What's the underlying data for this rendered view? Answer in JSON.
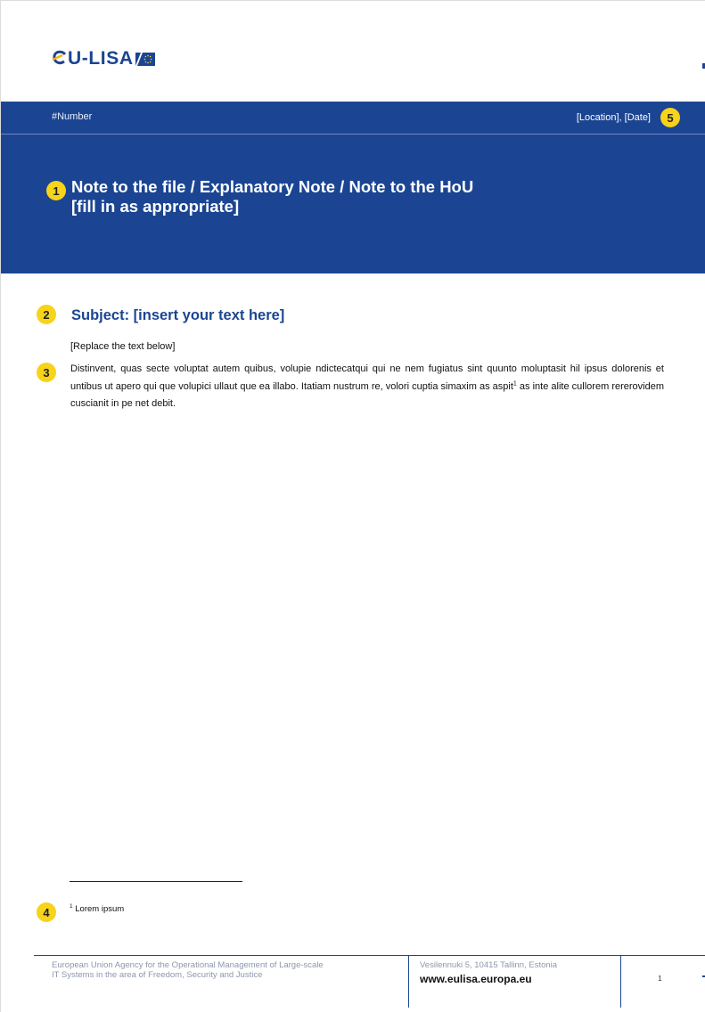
{
  "logo": {
    "text": "eU-LISA",
    "icon": "eu-flag-icon"
  },
  "header": {
    "number": "#Number",
    "location_date": "[Location], [Date]",
    "title_line1": "Note to the file / Explanatory Note / Note to the HoU",
    "title_line2": "[fill in as appropriate]"
  },
  "markers": [
    "1",
    "2",
    "3",
    "4",
    "5"
  ],
  "subject": "Subject: [insert your text here]",
  "replace_hint": "[Replace the text below]",
  "body": {
    "before_sup": "Distinvent, quas secte voluptat autem quibus, volupie ndictecatqui qui ne nem fugiatus sint quunto moluptasit hil ipsus dolorenis et untibus ut apero qui que volupici ullaut que ea illabo. Itatiam nustrum re, volori cuptia simaxim as aspit",
    "sup": "1",
    "after_sup": " as inte alite cullorem rererovidem cuscianit in pe net debit."
  },
  "footnote": {
    "sup": "1",
    "text": " Lorem ipsum"
  },
  "footer": {
    "agency_line1": "European Union Agency for the Operational Management of Large-scale",
    "agency_line2": "IT Systems in the area of Freedom, Security and Justice",
    "address": "Vesilennuki 5, 10415 Tallinn, Estonia",
    "url": "www.eulisa.europa.eu",
    "page_number": "1"
  },
  "colors": {
    "brand_blue": "#1b4592",
    "marker_yellow": "#f7d31a"
  }
}
